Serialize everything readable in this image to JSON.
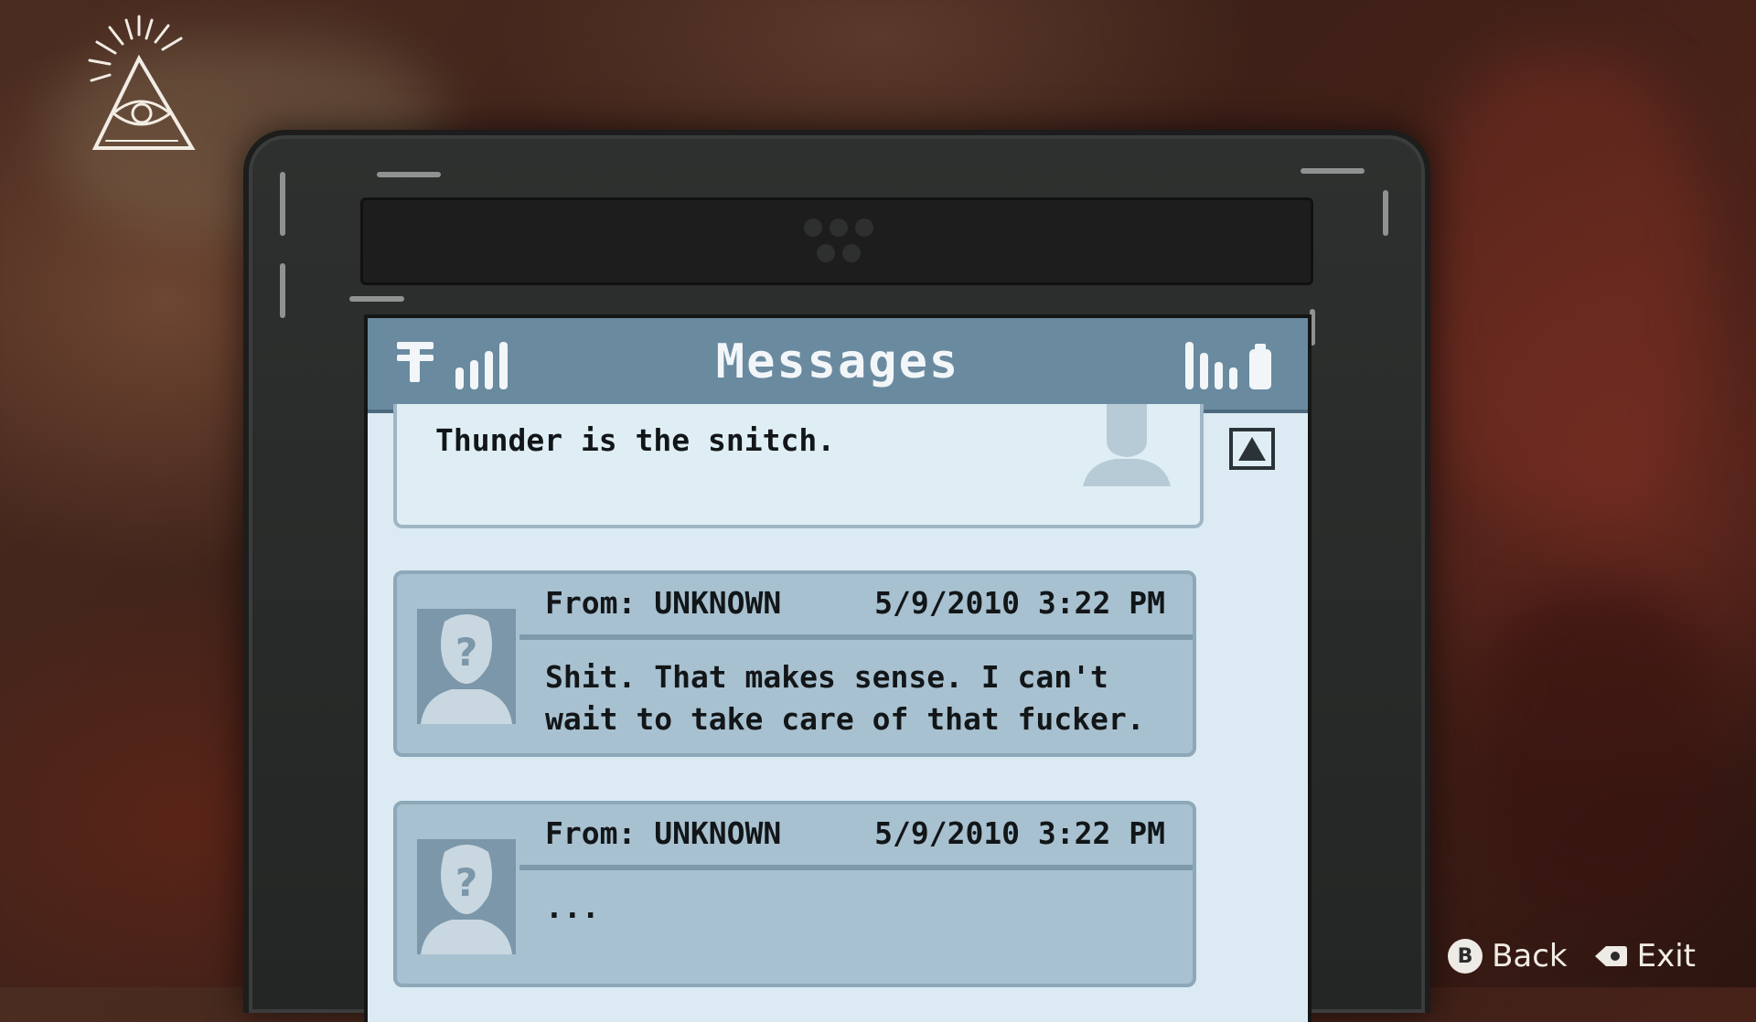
{
  "header": {
    "title": "Messages"
  },
  "messages": [
    {
      "type": "sent",
      "text": "Thunder is the snitch."
    },
    {
      "type": "received",
      "from": "From: UNKNOWN",
      "date": "5/9/2010 3:22 PM",
      "text": "Shit. That makes sense. I can't\nwait to take care of that fucker."
    },
    {
      "type": "received",
      "from": "From: UNKNOWN",
      "date": "5/9/2010 3:22 PM",
      "text": "..."
    }
  ],
  "hints": {
    "back_button_glyph": "B",
    "back_label": "Back",
    "exit_label": "Exit"
  },
  "colors": {
    "status_bar": "#6a8aa0",
    "screen_bg": "#dcebf3",
    "card_bg": "#a8c1d0",
    "phone_body": "#2e302f"
  },
  "icons": [
    "eye-of-providence-logo",
    "network-icon",
    "signal-icon",
    "battery-icon",
    "scroll-up-icon",
    "avatar-icon"
  ]
}
